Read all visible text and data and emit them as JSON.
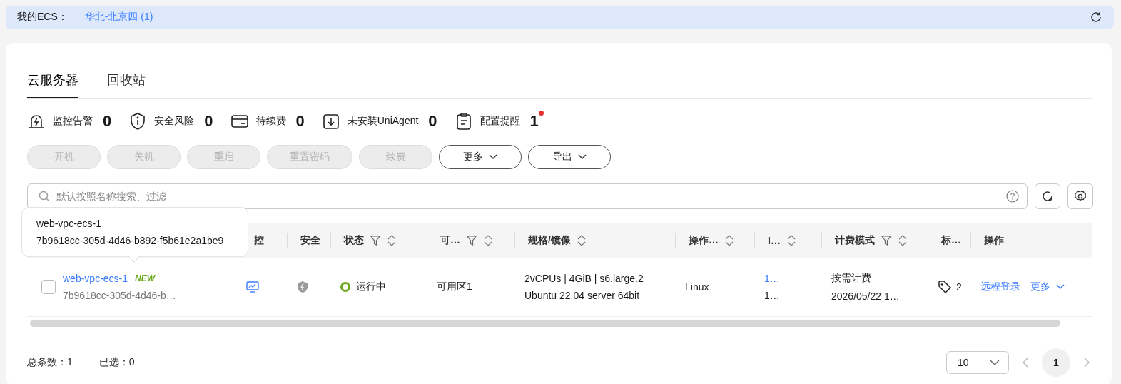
{
  "region_bar": {
    "label": "我的ECS：",
    "region": "华北-北京四 (1)"
  },
  "tabs": [
    {
      "label": "云服务器",
      "selected": true
    },
    {
      "label": "回收站",
      "selected": false
    }
  ],
  "stats": [
    {
      "kind": "alarm",
      "label": "监控告警",
      "count": "0",
      "alert": false
    },
    {
      "kind": "shield",
      "label": "安全风险",
      "count": "0",
      "alert": false
    },
    {
      "kind": "card",
      "label": "待续费",
      "count": "0",
      "alert": false
    },
    {
      "kind": "download",
      "label": "未安装UniAgent",
      "count": "0",
      "alert": false
    },
    {
      "kind": "clipboard",
      "label": "配置提醒",
      "count": "1",
      "alert": true
    }
  ],
  "action_buttons": [
    {
      "label": "开机",
      "disabled": true,
      "dropdown": false
    },
    {
      "label": "关机",
      "disabled": true,
      "dropdown": false
    },
    {
      "label": "重启",
      "disabled": true,
      "dropdown": false
    },
    {
      "label": "重置密码",
      "disabled": true,
      "dropdown": false
    },
    {
      "label": "续费",
      "disabled": true,
      "dropdown": false
    },
    {
      "label": "更多",
      "disabled": false,
      "dropdown": true
    },
    {
      "label": "导出",
      "disabled": false,
      "dropdown": true
    }
  ],
  "search": {
    "placeholder": "默认按照名称搜索、过滤"
  },
  "table": {
    "columns": [
      {
        "label": "控",
        "filter": false,
        "sort": false
      },
      {
        "label": "安全",
        "filter": false,
        "sort": false
      },
      {
        "label": "状态",
        "filter": true,
        "sort": true
      },
      {
        "label": "可…",
        "filter": true,
        "sort": true
      },
      {
        "label": "规格/镜像",
        "filter": false,
        "sort": true
      },
      {
        "label": "操作…",
        "filter": false,
        "sort": true
      },
      {
        "label": "I…",
        "filter": false,
        "sort": true
      },
      {
        "label": "计费模式",
        "filter": true,
        "sort": true
      },
      {
        "label": "标…",
        "filter": false,
        "sort": false
      },
      {
        "label": "操作",
        "filter": false,
        "sort": false
      }
    ],
    "rows": [
      {
        "checked": false,
        "name": "web-vpc-ecs-1",
        "badge": "NEW",
        "id": "7b9618cc-305d-4d46-b…",
        "status": "运行中",
        "zone": "可用区1",
        "spec": [
          "2vCPUs | 4GiB | s6.large.2",
          "Ubuntu 22.04 server 64bit"
        ],
        "os": "Linux",
        "ip": [
          "1…",
          "1…"
        ],
        "billing": [
          "按需计费",
          "2026/05/22 1…"
        ],
        "tag_count": "2",
        "actions": [
          "远程登录",
          "更多"
        ]
      }
    ]
  },
  "tooltip": {
    "lines": [
      "web-vpc-ecs-1",
      "7b9618cc-305d-4d46-b892-f5b61e2a1be9"
    ]
  },
  "footer": {
    "total": "总条数：1",
    "selected": "已选：0",
    "page_size": "10",
    "pages": [
      {
        "label": "1",
        "selected": true
      }
    ]
  }
}
